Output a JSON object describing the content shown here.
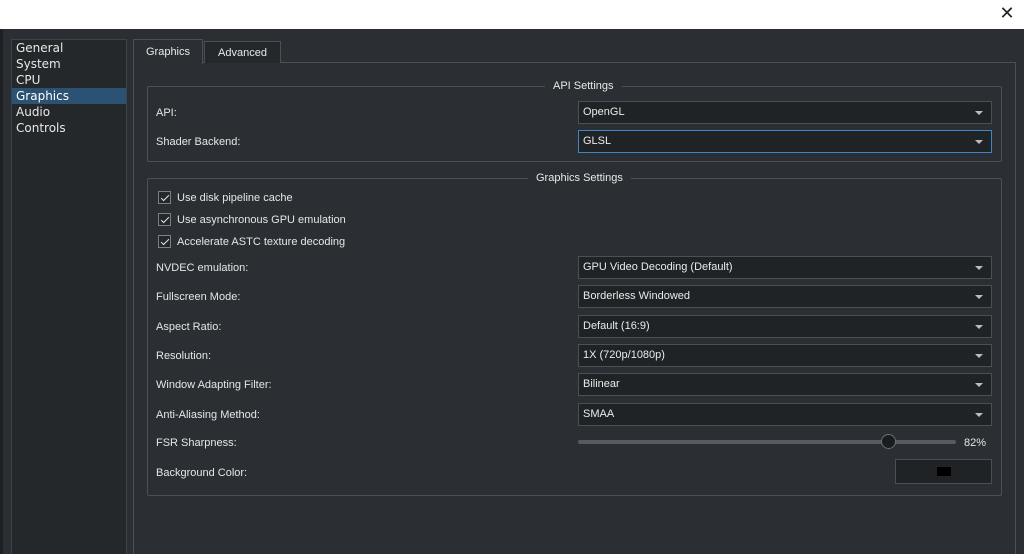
{
  "window": {
    "close_icon": "close-icon",
    "close_glyph": "✕"
  },
  "sidebar": {
    "items": [
      {
        "label": "General"
      },
      {
        "label": "System"
      },
      {
        "label": "CPU"
      },
      {
        "label": "Graphics",
        "active": true
      },
      {
        "label": "Audio"
      },
      {
        "label": "Controls"
      }
    ]
  },
  "tabs": [
    {
      "label": "Graphics",
      "active": true
    },
    {
      "label": "Advanced"
    }
  ],
  "api_settings": {
    "title": "API Settings",
    "api_label": "API:",
    "api_value": "OpenGL",
    "shader_label": "Shader Backend:",
    "shader_value": "GLSL"
  },
  "graphics_settings": {
    "title": "Graphics Settings",
    "checkboxes": [
      {
        "label": "Use disk pipeline cache",
        "checked": true
      },
      {
        "label": "Use asynchronous GPU emulation",
        "checked": true
      },
      {
        "label": "Accelerate ASTC texture decoding",
        "checked": true
      }
    ],
    "nvdec_label": "NVDEC emulation:",
    "nvdec_value": "GPU Video Decoding (Default)",
    "fullscreen_label": "Fullscreen Mode:",
    "fullscreen_value": "Borderless Windowed",
    "aspect_label": "Aspect Ratio:",
    "aspect_value": "Default (16:9)",
    "resolution_label": "Resolution:",
    "resolution_value": "1X (720p/1080p)",
    "filter_label": "Window Adapting Filter:",
    "filter_value": "Bilinear",
    "aa_label": "Anti-Aliasing Method:",
    "aa_value": "SMAA",
    "fsr_label": "FSR Sharpness:",
    "fsr_value": "82%",
    "fsr_fraction": 0.82,
    "bg_label": "Background Color:",
    "bg_color": "#000000"
  },
  "colors": {
    "accent": "#2b5273",
    "focus": "#3f86c6",
    "background": "#2b2f33"
  }
}
